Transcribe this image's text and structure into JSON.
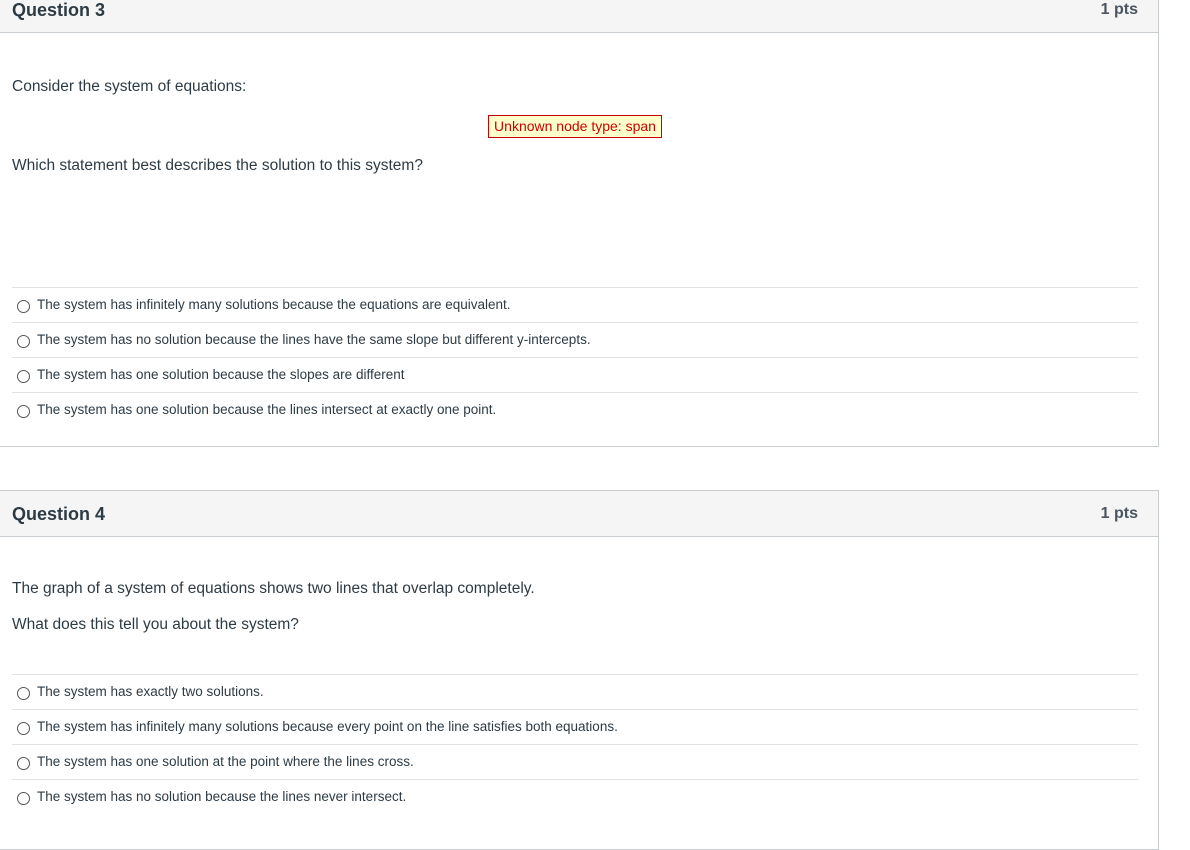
{
  "questions": [
    {
      "title": "Question 3",
      "points": "1 pts",
      "prompt": "Consider the system of equations:",
      "render_error": "Unknown node type: span",
      "question": "Which statement best describes the solution to this system?",
      "answers": [
        "The system has infinitely many solutions because the equations are equivalent.",
        "The system has no solution because the lines have the same slope but different y-intercepts.",
        "The system has one solution because the slopes are different",
        "The system has one solution because the lines intersect at exactly one point."
      ]
    },
    {
      "title": "Question 4",
      "points": "1 pts",
      "prompt": "The graph of a system of equations shows two lines that overlap completely.",
      "question": "What does this tell you about the system?",
      "answers": [
        "The system has exactly two solutions.",
        "The system has infinitely many solutions because every point on the line satisfies both equations.",
        "The system has one solution at the point where the lines cross.",
        "The system has no solution because the lines never intersect."
      ]
    }
  ]
}
